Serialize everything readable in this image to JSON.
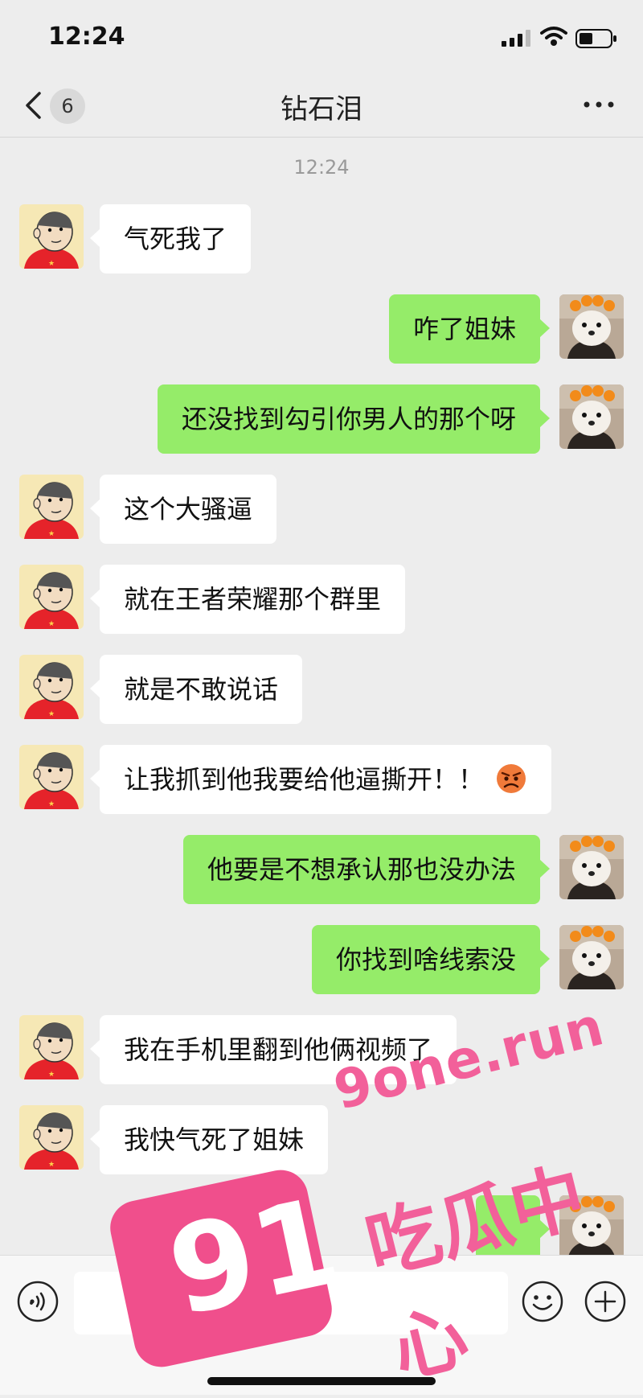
{
  "status_bar": {
    "time": "12:24"
  },
  "nav": {
    "back_count": "6",
    "title": "钻石泪"
  },
  "timestamp": "12:24",
  "messages": [
    {
      "side": "left",
      "text": "气死我了"
    },
    {
      "side": "right",
      "text": "咋了姐妹"
    },
    {
      "side": "right",
      "text": "还没找到勾引你男人的那个呀"
    },
    {
      "side": "left",
      "text": "这个大骚逼"
    },
    {
      "side": "left",
      "text": "就在王者荣耀那个群里"
    },
    {
      "side": "left",
      "text": "就是不敢说话"
    },
    {
      "side": "left",
      "text": "让我抓到他我要给他逼撕开！！",
      "emoji": "angry-face"
    },
    {
      "side": "right",
      "text": "他要是不想承认那也没办法"
    },
    {
      "side": "right",
      "text": "你找到啥线索没"
    },
    {
      "side": "left",
      "text": "我在手机里翻到他俩视频了"
    },
    {
      "side": "left",
      "text": "我快气死了姐妹"
    }
  ],
  "input_bar": {
    "text_value": ""
  },
  "watermark": {
    "url": "9one.run",
    "badge": "91",
    "cn": "吃瓜中心"
  },
  "colors": {
    "sent_bubble": "#95ec69",
    "received_bubble": "#ffffff",
    "background": "#ededed",
    "watermark": "#f04f8c"
  },
  "icons": {
    "back": "chevron-left-icon",
    "more": "more-dots-icon",
    "voice": "voice-icon",
    "emoji": "smiley-icon",
    "plus": "plus-icon"
  }
}
